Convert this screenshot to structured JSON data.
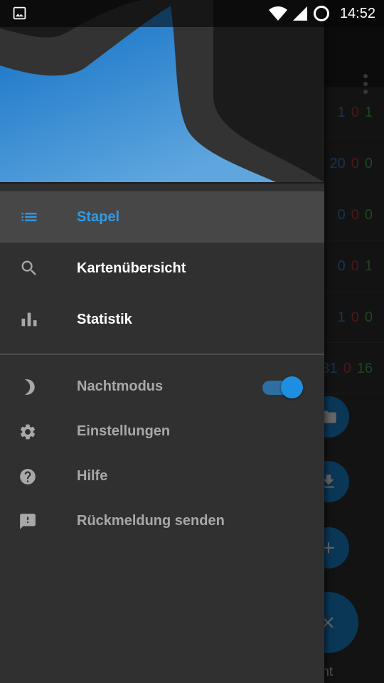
{
  "status_bar": {
    "time": "14:52",
    "icons": [
      "image-notification-icon",
      "wifi-icon",
      "cell-signal-icon",
      "battery-ring-icon"
    ]
  },
  "background": {
    "rows": [
      {
        "counts": [
          "1",
          "0",
          "1"
        ],
        "colors": [
          "#3f7fc4",
          "#c23b3b",
          "#4caf50"
        ]
      },
      {
        "counts": [
          "20",
          "0",
          "0"
        ],
        "colors": [
          "#3f7fc4",
          "#c23b3b",
          "#4caf50"
        ]
      },
      {
        "counts": [
          "0",
          "0",
          "0"
        ],
        "colors": [
          "#3f7fc4",
          "#c23b3b",
          "#4caf50"
        ]
      },
      {
        "counts": [
          "0",
          "0",
          "1"
        ],
        "colors": [
          "#3f7fc4",
          "#c23b3b",
          "#4caf50"
        ]
      },
      {
        "counts": [
          "1",
          "0",
          "0"
        ],
        "colors": [
          "#3f7fc4",
          "#c23b3b",
          "#4caf50"
        ]
      },
      {
        "counts": [
          "31",
          "0",
          "16"
        ],
        "colors": [
          "#3f7fc4",
          "#c23b3b",
          "#4caf50"
        ]
      }
    ],
    "fab_icons": [
      "folder-icon",
      "download-icon",
      "add-icon",
      "close-icon"
    ],
    "bottom_text": "rnt"
  },
  "drawer": {
    "nav": [
      {
        "label": "Stapel",
        "icon": "list-icon",
        "selected": true
      },
      {
        "label": "Kartenübersicht",
        "icon": "search-icon",
        "selected": false
      },
      {
        "label": "Statistik",
        "icon": "bar-chart-icon",
        "selected": false
      }
    ],
    "secondary": [
      {
        "label": "Nachtmodus",
        "icon": "moon-icon",
        "toggle_on": true
      },
      {
        "label": "Einstellungen",
        "icon": "gear-icon"
      },
      {
        "label": "Hilfe",
        "icon": "help-icon"
      },
      {
        "label": "Rückmeldung senden",
        "icon": "feedback-icon"
      }
    ]
  },
  "colors": {
    "accent": "#2f9be6",
    "fab": "#1a8ad8",
    "drawer_bg": "#303030",
    "selected_bg": "#474747",
    "header_sky": "#1a7fd0"
  }
}
